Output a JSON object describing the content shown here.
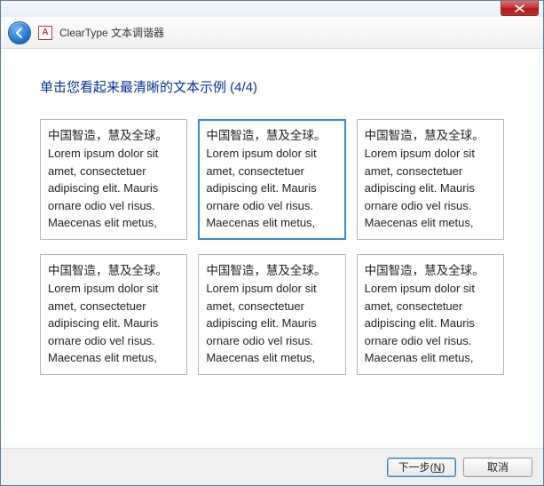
{
  "window": {
    "title": "ClearType 文本调谐器",
    "icon_letter": "A"
  },
  "heading": "单击您看起来最清晰的文本示例 (4/4)",
  "sample_text": {
    "cjk": "中国智造，慧及全球。",
    "latin": "Lorem ipsum dolor sit amet, consectetuer adipiscing elit. Mauris ornare odio vel risus. Maecenas elit metus,"
  },
  "samples": [
    {
      "selected": false
    },
    {
      "selected": true
    },
    {
      "selected": false
    },
    {
      "selected": false
    },
    {
      "selected": false
    },
    {
      "selected": false
    }
  ],
  "buttons": {
    "next_prefix": "下一步(",
    "next_accel": "N",
    "next_suffix": ")",
    "cancel": "取消"
  }
}
